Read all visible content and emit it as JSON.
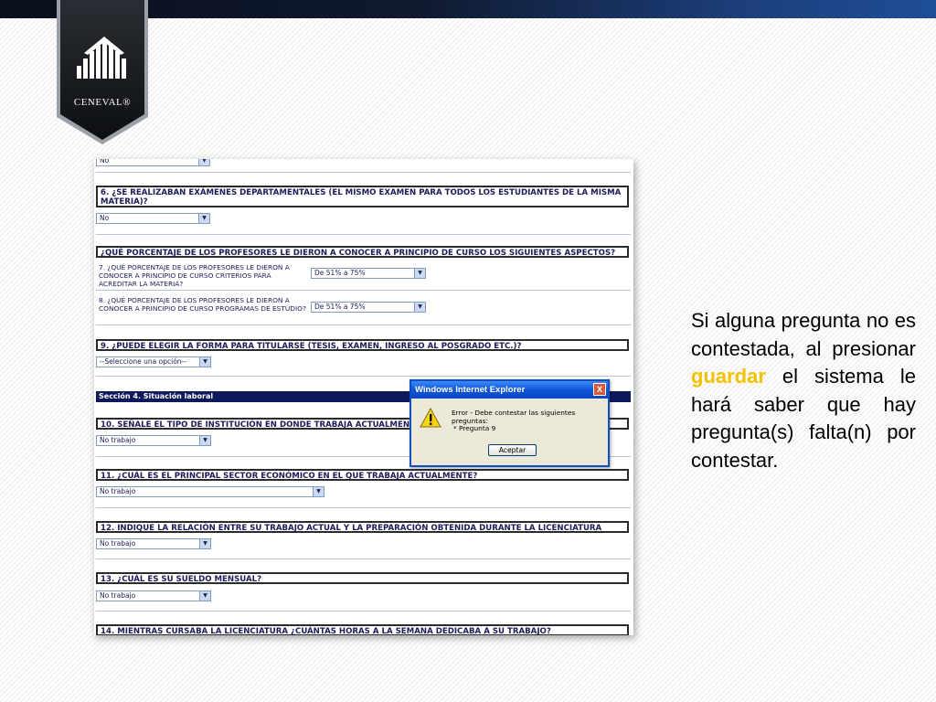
{
  "brand": {
    "logo_text": "CENEVAL®"
  },
  "form": {
    "top_select": "No",
    "q6": {
      "text": "6. ¿SE REALIZABAN EXÁMENES DEPARTAMENTALES (EL MISMO EXAMEN PARA TODOS LOS ESTUDIANTES DE LA MISMA MATERIA)?",
      "value": "No"
    },
    "group": {
      "text": "¿QUÉ PORCENTAJE DE LOS PROFESORES LE DIERON A CONOCER A PRINCIPIO DE CURSO LOS SIGUIENTES ASPECTOS?"
    },
    "q7": {
      "text": "7. ¿QUÉ PORCENTAJE DE LOS PROFESORES LE DIERON A CONOCER A PRINCIPIO DE CURSO CRITERIOS PARA ACREDITAR LA MATERIA?",
      "value": "De 51% a 75%"
    },
    "q8": {
      "text": "8. ¿QUÉ PORCENTAJE DE LOS PROFESORES LE DIERON A CONOCER A PRINCIPIO DE CURSO PROGRAMAS DE ESTUDIO?",
      "value": "De 51% a 75%"
    },
    "q9": {
      "text": "9. ¿PUEDE ELEGIR LA FORMA PARA TITULARSE (TESIS, EXAMEN, INGRESO AL POSGRADO ETC.)?",
      "value": "--Seleccione una opción--"
    },
    "section4": "Sección 4. Situación laboral",
    "q10": {
      "text": "10. SEÑALE EL TIPO DE INSTITUCIÓN EN DONDE TRABAJA ACTUALMENTE",
      "value": "No trabajo"
    },
    "q11": {
      "text": "11. ¿CUÁL ES EL PRINCIPAL SECTOR ECONÓMICO EN EL QUE TRABAJA ACTUALMENTE?",
      "value": "No trabajo"
    },
    "q12": {
      "text": "12. INDIQUE LA RELACIÓN ENTRE SU TRABAJO ACTUAL Y LA PREPARACIÓN OBTENIDA DURANTE LA LICENCIATURA",
      "value": "No trabajo"
    },
    "q13": {
      "text": "13. ¿CUÁL ES SU SUELDO MENSUAL?",
      "value": "No trabajo"
    },
    "q14": {
      "text": "14. MIENTRAS CURSABA LA LICENCIATURA ¿CUÁNTAS HORAS A LA SEMANA DEDICABA A SU TRABAJO?"
    }
  },
  "dialog": {
    "title": "Windows Internet Explorer",
    "close": "X",
    "message": "Error - Debe contestar las siguientes preguntas:",
    "item": "* Pregunta 9",
    "button": "Aceptar"
  },
  "side": {
    "before": "Si alguna pregunta no es contestada, al presionar ",
    "highlight": "guardar",
    "after": " el sistema le hará saber que hay pregunta(s) falta(n) por contestar.",
    "highlight_color": "#f2c200"
  }
}
